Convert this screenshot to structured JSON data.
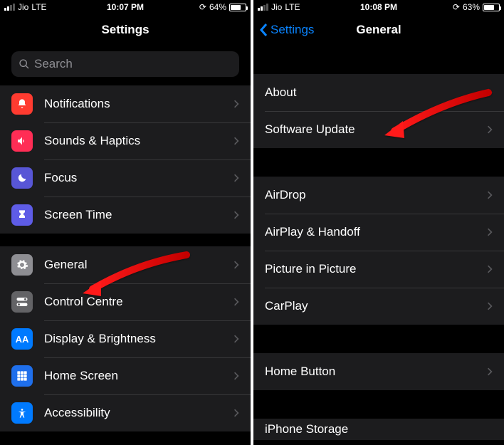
{
  "screen1": {
    "status": {
      "carrier": "Jio",
      "net": "LTE",
      "time": "10:07 PM",
      "battery": "64%",
      "battery_fill_pct": 64
    },
    "title": "Settings",
    "search_placeholder": "Search",
    "groups": [
      [
        {
          "label": "Notifications",
          "color": "c-red",
          "icon": "bell"
        },
        {
          "label": "Sounds & Haptics",
          "color": "c-pink",
          "icon": "speaker"
        },
        {
          "label": "Focus",
          "color": "c-indigo",
          "icon": "moon"
        },
        {
          "label": "Screen Time",
          "color": "c-purple",
          "icon": "hourglass"
        }
      ],
      [
        {
          "label": "General",
          "color": "c-gray",
          "icon": "gear"
        },
        {
          "label": "Control Centre",
          "color": "c-gray2",
          "icon": "toggles"
        },
        {
          "label": "Display & Brightness",
          "color": "c-blue",
          "icon": "aa"
        },
        {
          "label": "Home Screen",
          "color": "c-blue2",
          "icon": "grid"
        },
        {
          "label": "Accessibility",
          "color": "c-blue",
          "icon": "person"
        }
      ]
    ]
  },
  "screen2": {
    "status": {
      "carrier": "Jio",
      "net": "LTE",
      "time": "10:08 PM",
      "battery": "63%",
      "battery_fill_pct": 63
    },
    "back": "Settings",
    "title": "General",
    "groups": [
      [
        {
          "label": "About"
        },
        {
          "label": "Software Update"
        }
      ],
      [
        {
          "label": "AirDrop"
        },
        {
          "label": "AirPlay & Handoff"
        },
        {
          "label": "Picture in Picture"
        },
        {
          "label": "CarPlay"
        }
      ],
      [
        {
          "label": "Home Button"
        }
      ],
      [
        {
          "label": "iPhone Storage"
        }
      ]
    ]
  }
}
